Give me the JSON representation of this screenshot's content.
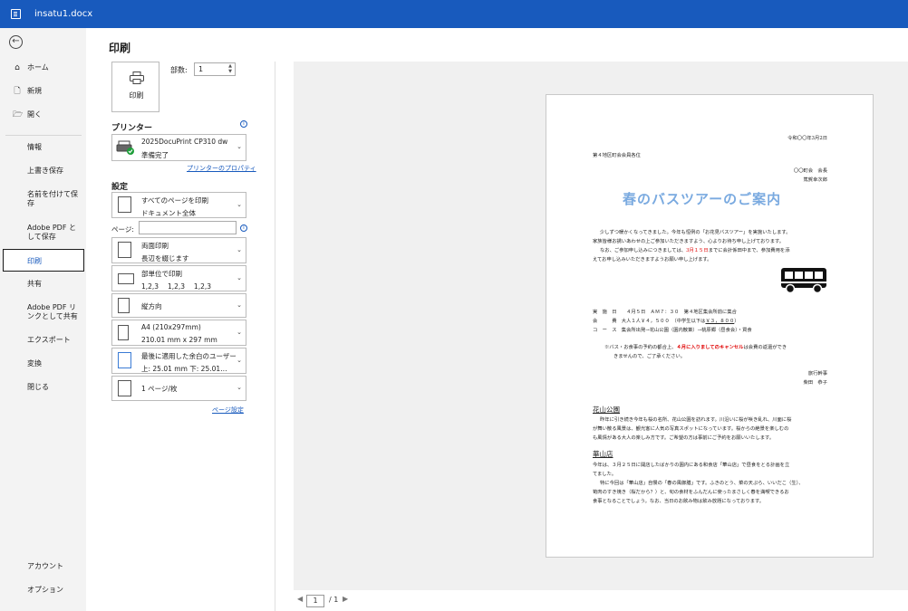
{
  "window": {
    "filename": "insatu1.docx"
  },
  "sidebar": {
    "top_items": [
      {
        "label": "ホーム",
        "icon": "home-icon"
      },
      {
        "label": "新規",
        "icon": "new-document-icon"
      },
      {
        "label": "開く",
        "icon": "folder-icon"
      }
    ],
    "items": [
      "情報",
      "上書き保存",
      "名前を付けて保存",
      "Adobe PDF として保存",
      "印刷",
      "共有",
      "Adobe PDF リンクとして共有",
      "エクスポート",
      "変換",
      "閉じる"
    ],
    "bottom_items": [
      "アカウント",
      "オプション"
    ],
    "selected": "印刷"
  },
  "print": {
    "heading": "印刷",
    "print_button": "印刷",
    "copies_label": "部数:",
    "copies_value": "1",
    "printer_section": "プリンター",
    "printer_name": "2025DocuPrint CP310 dw",
    "printer_status": "準備完了",
    "printer_properties_link": "プリンターのプロパティ",
    "settings_section": "設定",
    "settings": [
      {
        "line1": "すべてのページを印刷",
        "line2": "ドキュメント全体"
      },
      {
        "line1": "両面印刷",
        "line2": "長辺を綴じます"
      },
      {
        "line1": "部単位で印刷",
        "line2": "1,2,3　 1,2,3　 1,2,3"
      },
      {
        "line1": "縦方向",
        "line2": ""
      },
      {
        "line1": "A4 (210x297mm)",
        "line2": "210.01 mm x 297 mm"
      },
      {
        "line1": "最後に適用した余白のユーザー…",
        "line2": "上: 25.01 mm 下: 25.01…"
      },
      {
        "line1": "1 ページ/枚",
        "line2": ""
      }
    ],
    "pages_label": "ページ:",
    "pages_value": "",
    "page_setup_link": "ページ設定",
    "current_page": "1",
    "total_pages": "/ 1"
  },
  "document": {
    "date": "令和〇〇年3月2日",
    "to": "第４地区町会会員各位",
    "from1": "〇〇町会　会長",
    "from2": "篤賀幸次郎",
    "title": "春のバスツアーのご案内",
    "p1": "少しずつ暖かくなってきました。今年も恒例の「お花見バスツアー」を実施いたします。",
    "p2": "家族皆様お誘いあわせの上ご参加いただきますよう、心よりお待ち申し上げております。",
    "p3a": "なお、ご参加申し込みにつきましては、",
    "p3red": "3月１５日",
    "p3b": "までに会計係田中まで、参加費用を添",
    "p4": "えてお申し込みいただきますようお願い申し上げます。",
    "d1": "実　施　日　　４月５日　ＡＭ７：３０　第４地区集会所前に集合",
    "d2": "会　　　費　大人１人￥４，５００　（中学生以下は",
    "d2u": "￥３，８００",
    "d2e": "）",
    "d3": "コ　ー　ス　集会所出発→花山公園（園内散策）→桃原郷（昼食会）・買食",
    "n1a": "※バス・お食事の予約の都合上、",
    "n1red": "４月に入りましてのキャンセル",
    "n1b": "は会費の返還ができ",
    "n2": "きませんので、ご了承ください。",
    "s1": "旅行幹事",
    "s2": "柴田　恭子",
    "h1": "花山公園",
    "h1p1": "昨年に引き続き今年も桜の名所、花山公園を訪れます。川沿いに桜が咲き乱れ、川面に桜",
    "h1p2": "が舞い散る風景は、観光客に人気の写真スポットになっています。桜からの絶景を楽しむの",
    "h1p3": "も風情がある大人の楽しみ方です。ご希望の方は事前にご予約をお願いいたします。",
    "h2": "華山店",
    "h2p1": "今年は、３月２５日に開店したばかりの園内にある和食店「華山店」で昼食をとる計画を立",
    "h2p2": "てました。",
    "h2p3": "特に今回は「華山店」自慢の「春の風御膳」です。ふきのとう、菜の天ぷら、いいだこ（生）、",
    "h2p4": "筍肉のすき焼き（桜だから？）と、旬の食材をふんだんに使ったまさしく春を満喫できるお",
    "h2p5": "食事となることでしょう。なお、当日のお飲み物は飲み放題になっております。"
  }
}
